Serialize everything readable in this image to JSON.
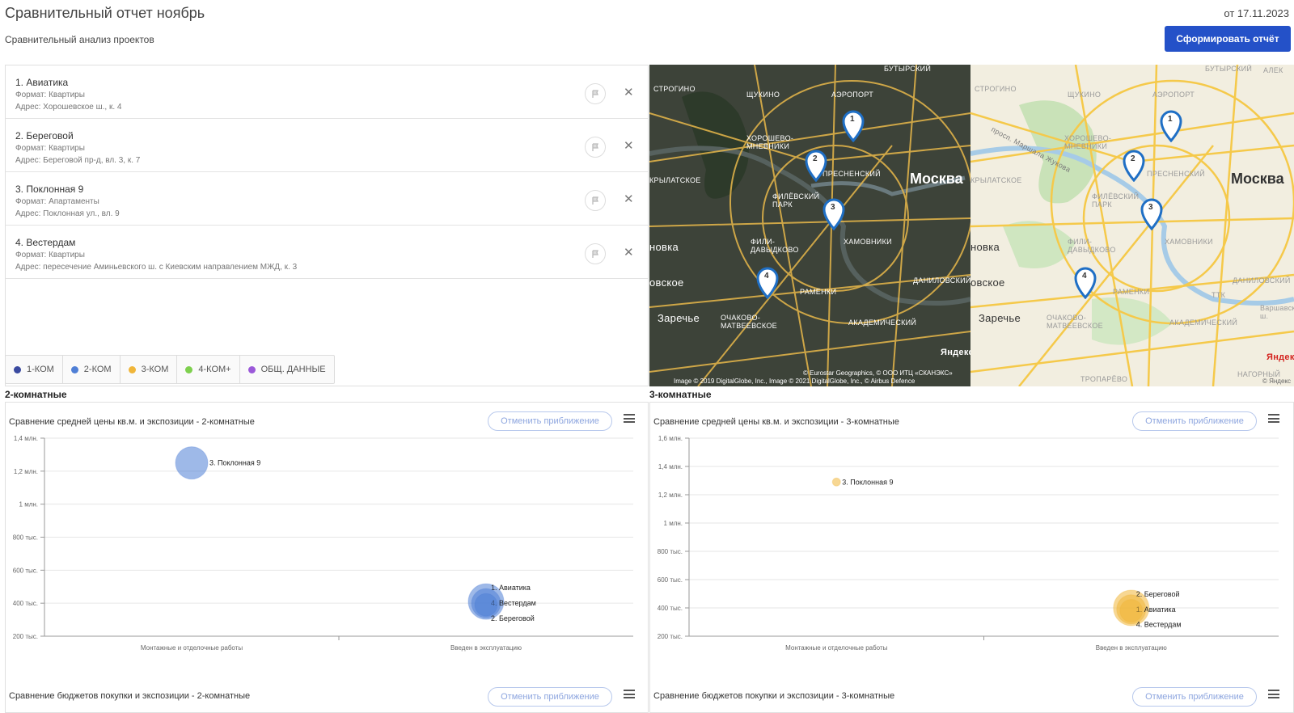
{
  "header": {
    "title": "Сравнительный отчет ноябрь",
    "subtitle": "Сравнительный анализ проектов",
    "date": "от 17.11.2023",
    "report_button": "Сформировать отчёт"
  },
  "projects": [
    {
      "name": "1. Авиатика",
      "format": "Формат: Квартиры",
      "address": "Адрес: Хорошевское ш., к. 4"
    },
    {
      "name": "2. Береговой",
      "format": "Формат: Квартиры",
      "address": "Адрес: Береговой пр-д, вл. 3, к. 7"
    },
    {
      "name": "3. Поклонная 9",
      "format": "Формат: Апартаменты",
      "address": "Адрес: Поклонная ул., вл. 9"
    },
    {
      "name": "4. Вестердам",
      "format": "Формат: Квартиры",
      "address": "Адрес: пересечение Аминьевского ш. с Киевским направлением МЖД, к. 3"
    }
  ],
  "legend": [
    {
      "label": "1-КОМ",
      "color": "#3a4aa0"
    },
    {
      "label": "2-КОМ",
      "color": "#4f7fd6"
    },
    {
      "label": "3-КОМ",
      "color": "#f0b63a"
    },
    {
      "label": "4-КОМ+",
      "color": "#7ed04e"
    },
    {
      "label": "ОБЩ. ДАННЫЕ",
      "color": "#9b59d9"
    }
  ],
  "map": {
    "city": "Москва",
    "places": [
      "ЩУКИНО",
      "АЭРОПОРТ",
      "СТРОГИНО",
      "ХОРОШЕВО-МНЕВНИКИ",
      "КРЫЛАТСКОЕ",
      "ПРЕСНЕНСКИЙ",
      "ФИЛЁВСКИЙ ПАРК",
      "ХАМОВНИКИ",
      "ФИЛИ-ДАВЫДКОВО",
      "РАМЕНКИ",
      "ОЧАКОВО-МАТВЕЕВСКОЕ",
      "АКАДЕМИЧЕСКИЙ",
      "ДАНИЛОВСКИЙ",
      "БУТЫРСКИЙ",
      "Заречье",
      "новка",
      "овское",
      "просп. Маршала Жукова",
      "Яндекс"
    ],
    "markers": [
      "1",
      "2",
      "3",
      "4"
    ],
    "copyright_sat": "© Eurostar Geographics, © ООО ИТЦ «СКАНЭКС»",
    "copyright_sat2": "Image © 2019 DigitalGlobe, Inc., Image © 2021 DigitalGlobe, Inc., © Airbus Defence",
    "copyright_scheme": "© Яндекс",
    "extra_places": [
      "ТРОПАРЁВО",
      "НАГОРНЫЙ",
      "ТТК",
      "Варшавское ш.",
      "АЛЕК"
    ]
  },
  "sections": [
    {
      "title": "2-комнатные"
    },
    {
      "title": "3-комнатные"
    }
  ],
  "chart_data": [
    {
      "type": "scatter",
      "title": "Сравнение средней цены кв.м. и экспозиции - 2-комнатные",
      "categories": [
        "Монтажные и отделочные работы",
        "Введен в эксплуатацию"
      ],
      "ytick_labels": [
        "200 тыс.",
        "400 тыс.",
        "600 тыс.",
        "800 тыс.",
        "1 млн.",
        "1,2 млн.",
        "1,4 млн."
      ],
      "ylim": [
        200000,
        1400000
      ],
      "color": "#4f7fd6",
      "points": [
        {
          "label": "3. Поклонная 9",
          "category": "Монтажные и отделочные работы",
          "y": 1250000
        },
        {
          "label": "1. Авиатика",
          "category": "Введен в эксплуатацию",
          "y": 410000
        },
        {
          "label": "4. Вестердам",
          "category": "Введен в эксплуатацию",
          "y": 400000
        },
        {
          "label": "2. Береговой",
          "category": "Введен в эксплуатацию",
          "y": 390000
        }
      ]
    },
    {
      "type": "scatter",
      "title": "Сравнение средней цены кв.м. и экспозиции - 3-комнатные",
      "categories": [
        "Монтажные и отделочные работы",
        "Введен в эксплуатацию"
      ],
      "ytick_labels": [
        "200 тыс.",
        "400 тыс.",
        "600 тыс.",
        "800 тыс.",
        "1 млн.",
        "1,2 млн.",
        "1,4 млн.",
        "1,6 млн."
      ],
      "ylim": [
        200000,
        1600000
      ],
      "color": "#f0b63a",
      "points": [
        {
          "label": "3. Поклонная 9",
          "category": "Монтажные и отделочные работы",
          "y": 1290000
        },
        {
          "label": "2. Береговой",
          "category": "Введен в эксплуатацию",
          "y": 400000
        },
        {
          "label": "1. Авиатика",
          "category": "Введен в эксплуатацию",
          "y": 390000
        },
        {
          "label": "4. Вестердам",
          "category": "Введен в эксплуатацию",
          "y": 380000
        }
      ]
    }
  ],
  "chart_buttons": {
    "reset": "Отменить приближение"
  },
  "second_charts": [
    {
      "title": "Сравнение бюджетов покупки и экспозиции - 2-комнатные"
    },
    {
      "title": "Сравнение бюджетов покупки и экспозиции - 3-комнатные"
    }
  ]
}
